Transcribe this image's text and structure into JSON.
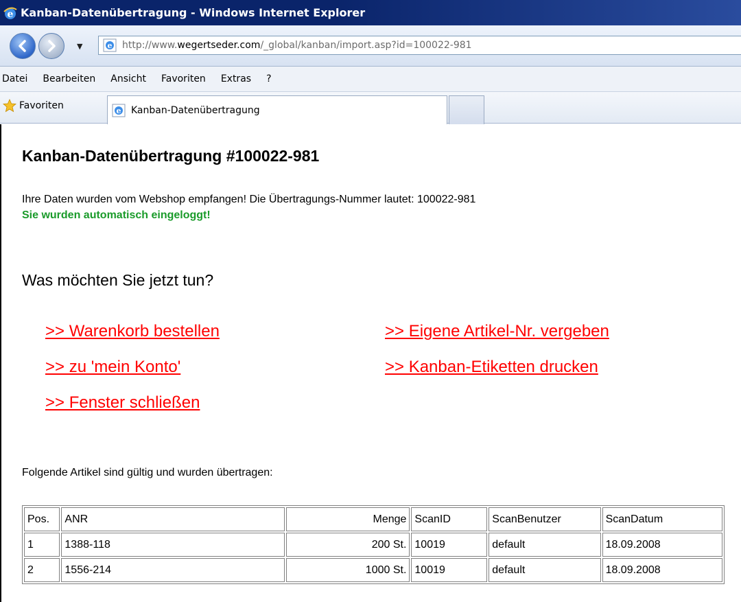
{
  "window": {
    "title": "Kanban-Datenübertragung - Windows Internet Explorer",
    "icon": "ie-icon"
  },
  "address": {
    "url_prefix": "http://www.",
    "url_domain": "wegertseder.com",
    "url_path": "/_global/kanban/import.asp?id=100022-981"
  },
  "menu": {
    "items": [
      "Datei",
      "Bearbeiten",
      "Ansicht",
      "Favoriten",
      "Extras",
      "?"
    ]
  },
  "favorites": {
    "label": "Favoriten",
    "tab_title": "Kanban-Datenübertragung"
  },
  "page": {
    "heading": "Kanban-Datenübertragung #100022-981",
    "info_text": "Ihre Daten wurden vom Webshop empfangen! Die Übertragungs-Nummer lautet: 100022-981",
    "login_text": "Sie wurden automatisch eingeloggt!",
    "question": "Was möchten Sie jetzt tun?",
    "links": {
      "warenkorb": ">> Warenkorb bestellen",
      "konto": ">> zu 'mein Konto'",
      "fenster": ">> Fenster schließen",
      "artikelnr": ">> Eigene Artikel-Nr. vergeben",
      "etiketten": ">> Kanban-Etiketten drucken"
    },
    "table_caption": "Folgende Artikel sind gültig und wurden übertragen:",
    "table": {
      "headers": [
        "Pos.",
        "ANR",
        "Menge",
        "ScanID",
        "ScanBenutzer",
        "ScanDatum"
      ],
      "rows": [
        [
          "1",
          "1388-118",
          "200 St.",
          "10019",
          "default",
          "18.09.2008"
        ],
        [
          "2",
          "1556-214",
          "1000 St.",
          "10019",
          "default",
          "18.09.2008"
        ]
      ]
    }
  },
  "colors": {
    "link": "#ff0000",
    "success": "#1a9b2a",
    "titlebar": "#0a246a"
  }
}
